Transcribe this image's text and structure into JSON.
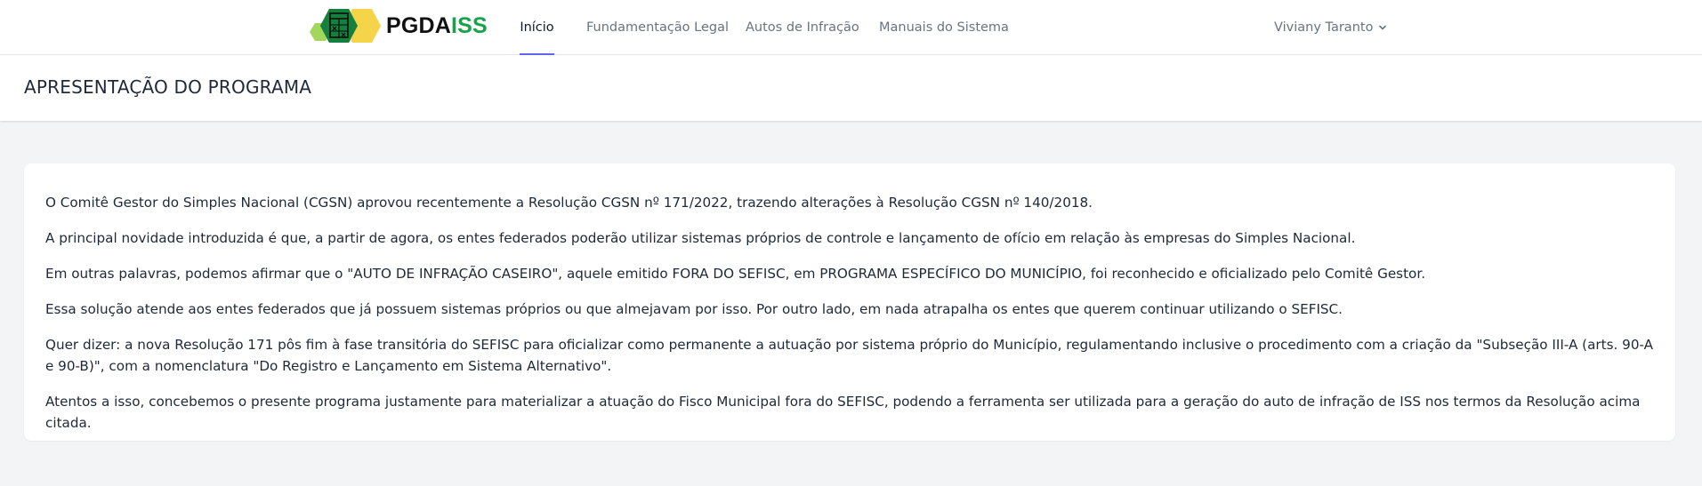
{
  "brand": {
    "name_part1": "PGDA",
    "name_part2": "ISS",
    "colors": {
      "dark_green": "#15803d",
      "light_green": "#a3d65c",
      "yellow": "#f5d44a",
      "iss_green": "#16a34a"
    },
    "icon": "spreadsheet-hexagon-logo"
  },
  "nav": {
    "items": [
      {
        "label": "Início",
        "active": true
      },
      {
        "label": "Fundamentação Legal",
        "active": false
      },
      {
        "label": "Autos de Infração",
        "active": false
      },
      {
        "label": "Manuais do Sistema",
        "active": false
      }
    ],
    "active_indicator_color": "#6366f1"
  },
  "user": {
    "name": "Viviany Taranto",
    "icon": "chevron-down-icon"
  },
  "page": {
    "title": "APRESENTAÇÃO DO PROGRAMA"
  },
  "content": {
    "paragraphs": [
      "O Comitê Gestor do Simples Nacional (CGSN) aprovou recentemente a Resolução CGSN nº 171/2022, trazendo alterações à Resolução CGSN nº 140/2018.",
      "A principal novidade introduzida é que, a partir de agora, os entes federados poderão utilizar sistemas próprios de controle e lançamento de ofício em relação às empresas do Simples Nacional.",
      "Em outras palavras, podemos afirmar que o \"AUTO DE INFRAÇÃO CASEIRO\", aquele emitido FORA DO SEFISC, em PROGRAMA ESPECÍFICO DO MUNICÍPIO, foi reconhecido e oficializado pelo Comitê Gestor.",
      "Essa solução atende aos entes federados que já possuem sistemas próprios ou que almejavam por isso. Por outro lado, em nada atrapalha os entes que querem continuar utilizando o SEFISC.",
      "Quer dizer: a nova Resolução 171 pôs fim à fase transitória do SEFISC para oficializar como permanente a autuação por sistema próprio do Município, regulamentando inclusive o procedimento com a criação da \"Subseção III-A (arts. 90-A e 90-B)\", com a nomenclatura \"Do Registro e Lançamento em Sistema Alternativo\".",
      "Atentos a isso, concebemos o presente programa justamente para materializar a atuação do Fisco Municipal fora do SEFISC, podendo a ferramenta ser utilizada para a geração do auto de infração de ISS nos termos da Resolução acima citada."
    ]
  }
}
